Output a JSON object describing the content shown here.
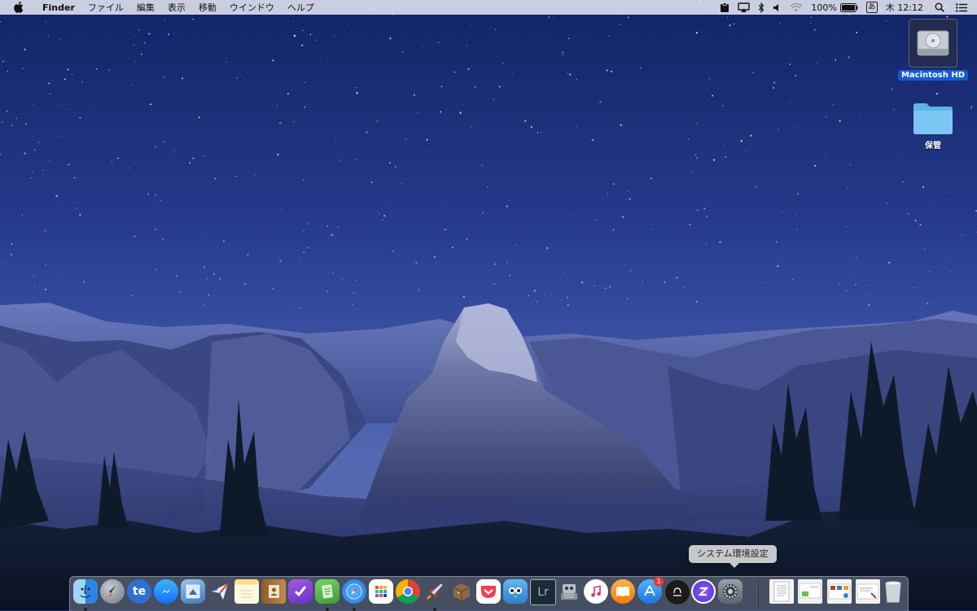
{
  "menubar": {
    "app_name": "Finder",
    "menus": [
      "ファイル",
      "編集",
      "表示",
      "移動",
      "ウインドウ",
      "ヘルプ"
    ],
    "status": {
      "battery_percent": "100%",
      "input_method": "あ",
      "clock": "木 12:12"
    },
    "status_icons": [
      "clipboard-icon",
      "airplay-icon",
      "bluetooth-icon",
      "volume-icon",
      "wifi-icon",
      "battery-icon",
      "search-icon",
      "notification-center-icon"
    ]
  },
  "desktop": {
    "icons": [
      {
        "label": "Macintosh HD",
        "icon": "hard-drive-icon",
        "selected": true
      },
      {
        "label": "保管",
        "icon": "folder-icon",
        "selected": false
      }
    ]
  },
  "dock": {
    "tooltip": "システム環境設定",
    "apps": [
      {
        "name": "finder",
        "running": true
      },
      {
        "name": "launchpad",
        "running": false
      },
      {
        "name": "te-app",
        "glyph": "te",
        "running": false
      },
      {
        "name": "messenger",
        "running": false
      },
      {
        "name": "mail-app",
        "running": false
      },
      {
        "name": "airmail",
        "running": false
      },
      {
        "name": "notes",
        "running": false
      },
      {
        "name": "contacts",
        "running": false
      },
      {
        "name": "omnifocus",
        "running": false
      },
      {
        "name": "evernote-like",
        "running": true
      },
      {
        "name": "safari",
        "running": true
      },
      {
        "name": "grid-app",
        "running": false
      },
      {
        "name": "chrome",
        "running": false
      },
      {
        "name": "rocket-app",
        "running": true
      },
      {
        "name": "package-app",
        "running": false
      },
      {
        "name": "pocket",
        "running": false
      },
      {
        "name": "tweetbot",
        "running": false
      },
      {
        "name": "lightroom",
        "glyph": "Lr",
        "running": false
      },
      {
        "name": "automator",
        "running": false
      },
      {
        "name": "itunes",
        "running": false
      },
      {
        "name": "ibooks",
        "running": false
      },
      {
        "name": "app-store",
        "badge": "1",
        "running": false
      },
      {
        "name": "dark-circle-app",
        "running": false
      },
      {
        "name": "z-app",
        "running": false
      },
      {
        "name": "system-preferences",
        "running": false
      }
    ],
    "stacks": [
      "document-stack",
      "preview-stack-1",
      "preview-stack-2",
      "preview-stack-3"
    ],
    "trash": "trash"
  }
}
